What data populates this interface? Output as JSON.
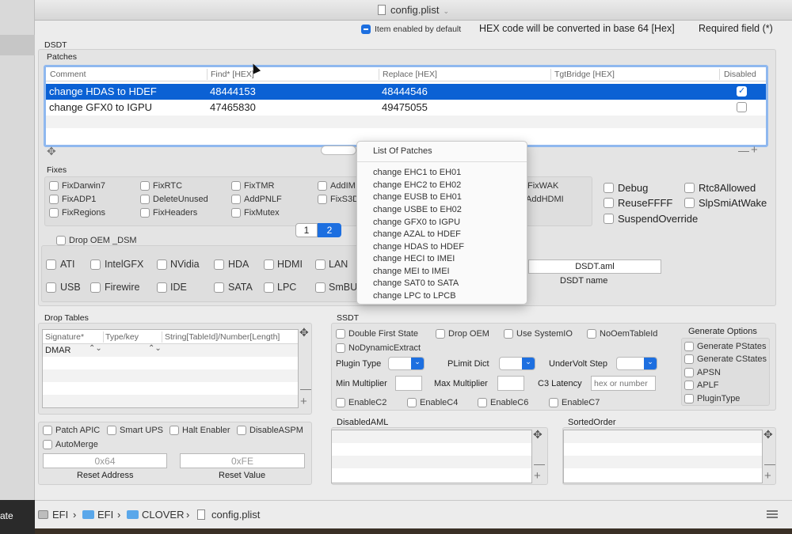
{
  "window": {
    "title": "config.plist",
    "left_strip_text": "ate"
  },
  "header": {
    "item_enabled_label": "Item enabled by default",
    "hex_note": "HEX code will be converted in base 64 [Hex]",
    "required_note": "Required field (*)"
  },
  "dsdt": {
    "section_label": "DSDT",
    "patches": {
      "label": "Patches",
      "columns": [
        "Comment",
        "Find* [HEX]",
        "Replace [HEX]",
        "TgtBridge [HEX]",
        "Disabled"
      ],
      "rows": [
        {
          "comment": "change HDAS to HDEF",
          "find": "48444153",
          "replace": "48444546",
          "tgt": "",
          "disabled": "✓"
        },
        {
          "comment": "change GFX0 to IGPU",
          "find": "47465830",
          "replace": "49475055",
          "tgt": "",
          "disabled": ""
        }
      ],
      "minus": "—",
      "plus": "+"
    },
    "fixes": {
      "label": "Fixes",
      "items": [
        "FixDarwin7",
        "FixRTC",
        "FixTMR",
        "AddIM",
        "FixWAK",
        "FixADP1",
        "DeleteUnused",
        "AddPNLF",
        "FixS3D",
        "AddHDMI",
        "FixRegions",
        "FixHeaders",
        "FixMutex"
      ],
      "extra": [
        "Debug",
        "Rtc8Allowed",
        "ReuseFFFF",
        "SlpSmiAtWake",
        "SuspendOverride"
      ]
    },
    "pages": [
      "1",
      "2"
    ],
    "drop_oem_dsm_label": "Drop OEM _DSM",
    "dsm": {
      "items": [
        "ATI",
        "IntelGFX",
        "NVidia",
        "HDA",
        "HDMI",
        "LAN",
        "USB",
        "Firewire",
        "IDE",
        "SATA",
        "LPC",
        "SmBU"
      ]
    },
    "dsdt_name": {
      "value": "DSDT.aml",
      "label": "DSDT name"
    }
  },
  "list_of_patches": {
    "title": "List Of Patches",
    "items": [
      "change EHC1 to EH01",
      "change EHC2 to EH02",
      "change EUSB to EH01",
      "change USBE to EH02",
      "change GFX0 to IGPU",
      "change AZAL to HDEF",
      "change HDAS to HDEF",
      "change HECI to IMEI",
      "change MEI to IMEI",
      "change SAT0 to SATA",
      "change LPC to LPCB"
    ]
  },
  "drop_tables": {
    "label": "Drop Tables",
    "columns": [
      "Signature*",
      "Type/key",
      "String[TableId]/Number[Length]"
    ],
    "rows": [
      {
        "signature": "DMAR"
      }
    ],
    "minus": "—",
    "plus": "+"
  },
  "misc": {
    "items": [
      "Patch APIC",
      "Smart UPS",
      "Halt Enabler",
      "DisableASPM",
      "AutoMerge"
    ],
    "reset_address": {
      "value": "0x64",
      "label": "Reset Address"
    },
    "reset_value": {
      "value": "0xFE",
      "label": "Reset Value"
    }
  },
  "ssdt": {
    "label": "SSDT",
    "row1": [
      "Double First State",
      "Drop OEM",
      "Use SystemIO",
      "NoOemTableId"
    ],
    "no_dynamic": "NoDynamicExtract",
    "plugin_type_label": "Plugin Type",
    "plimit_label": "PLimit Dict",
    "undervolt_label": "UnderVolt Step",
    "min_mult_label": "Min Multiplier",
    "max_mult_label": "Max Multiplier",
    "c3_label": "C3 Latency",
    "c3_placeholder": "hex or number",
    "c_states": [
      "EnableC2",
      "EnableC4",
      "EnableC6",
      "EnableC7"
    ],
    "generate_options": {
      "label": "Generate Options",
      "items": [
        "Generate PStates",
        "Generate CStates",
        "APSN",
        "APLF",
        "PluginType"
      ]
    }
  },
  "disabled_aml": {
    "label": "DisabledAML",
    "minus": "—",
    "plus": "+"
  },
  "sorted_order": {
    "label": "SortedOrder",
    "minus": "—",
    "plus": "+"
  },
  "pathbar": {
    "crumbs": [
      "EFI",
      "EFI",
      "CLOVER",
      "config.plist"
    ],
    "separator": "›"
  },
  "colors": {
    "accent": "#0b61d4",
    "window_bg": "#ececec",
    "group_bg": "#e4e4e4"
  },
  "icons": [
    "file-icon",
    "folder-icon",
    "drive-icon",
    "drag-handle-icon",
    "checkmark-icon",
    "chevron-down-icon",
    "list-icon"
  ]
}
